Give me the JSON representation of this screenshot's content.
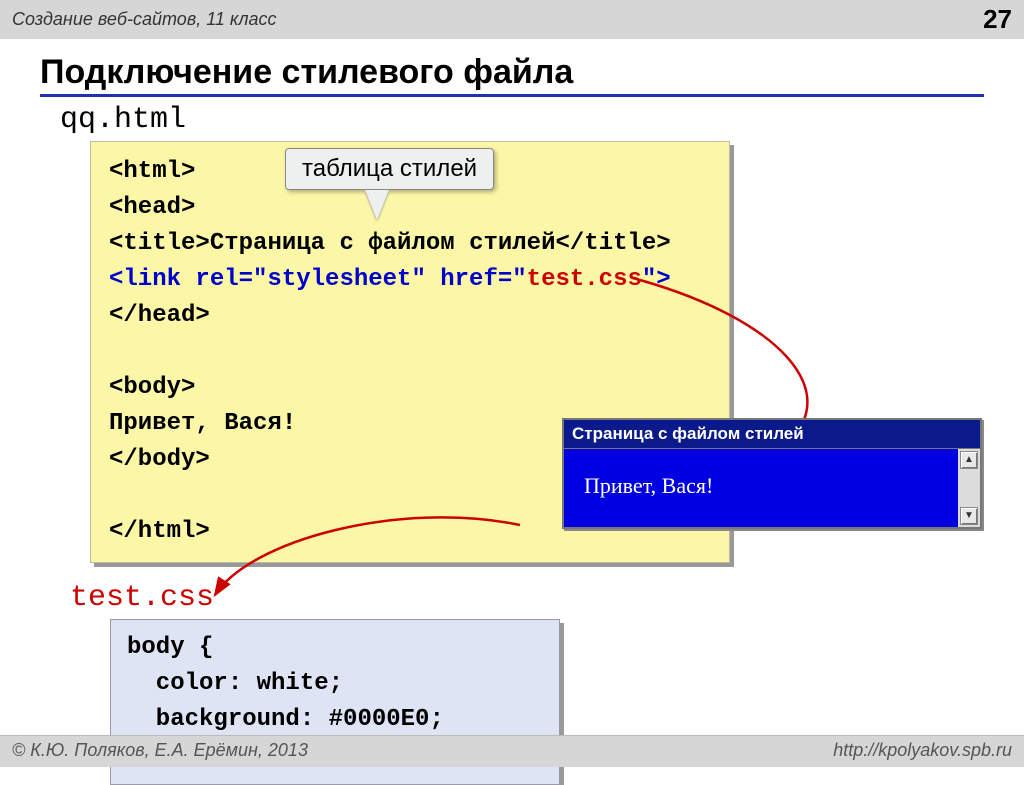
{
  "header": {
    "course": "Создание веб-сайтов, 11 класс",
    "page_number": "27"
  },
  "title": "Подключение стилевого файла",
  "filenames": {
    "html": "qq.html",
    "css": "test.css"
  },
  "callout": "таблица стилей",
  "code_html": {
    "l1": "<html>",
    "l2": "<head>",
    "l3a": "<title>",
    "l3b": "Страница с файлом стилей",
    "l3c": "</title>",
    "l4a": "<link rel=\"stylesheet\" href=\"",
    "l4b": "test.css",
    "l4c": "\">",
    "l5": "</head>",
    "l6": "<body>",
    "l7": "Привет, Вася!",
    "l8": "</body>",
    "l9": "</html>"
  },
  "code_css": {
    "l1": "body {",
    "l2": "  color: white;",
    "l3": "  background: #0000E0;",
    "l4": "}"
  },
  "preview": {
    "title": "Страница с файлом стилей",
    "body": "Привет, Вася!",
    "up": "▲",
    "down": "▼"
  },
  "footer": {
    "copyright": "© К.Ю. Поляков, Е.А. Ерёмин, 2013",
    "url": "http://kpolyakov.spb.ru"
  }
}
